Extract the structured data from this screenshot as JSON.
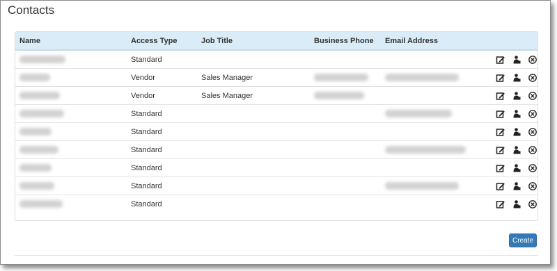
{
  "page": {
    "title": "Contacts"
  },
  "table": {
    "columns": [
      "Name",
      "Access Type",
      "Job Title",
      "Business Phone",
      "Email Address"
    ],
    "rows": [
      {
        "access_type": "Standard",
        "job_title": ""
      },
      {
        "access_type": "Vendor",
        "job_title": "Sales Manager"
      },
      {
        "access_type": "Vendor",
        "job_title": "Sales Manager"
      },
      {
        "access_type": "Standard",
        "job_title": ""
      },
      {
        "access_type": "Standard",
        "job_title": ""
      },
      {
        "access_type": "Standard",
        "job_title": ""
      },
      {
        "access_type": "Standard",
        "job_title": ""
      },
      {
        "access_type": "Standard",
        "job_title": ""
      },
      {
        "access_type": "Standard",
        "job_title": ""
      }
    ],
    "row_actions": [
      "edit-icon",
      "user-icon",
      "remove-icon"
    ]
  },
  "footer": {
    "create_label": "Create"
  },
  "colors": {
    "header_bg": "#d9ecf7",
    "button": "#337ab7"
  }
}
